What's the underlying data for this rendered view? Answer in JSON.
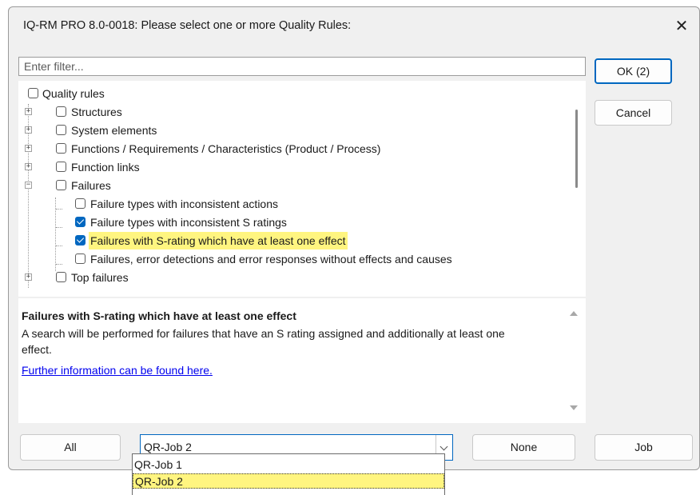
{
  "window": {
    "title": "IQ-RM PRO 8.0-0018: Please select one or more Quality Rules:",
    "close_glyph": "✕"
  },
  "filter": {
    "placeholder": "Enter filter...",
    "value": ""
  },
  "buttons": {
    "ok": "OK (2)",
    "cancel": "Cancel",
    "all": "All",
    "none": "None",
    "job": "Job"
  },
  "tree": {
    "root": {
      "label": "Quality rules",
      "checked": false
    },
    "groups": [
      {
        "label": "Structures",
        "expanded": false,
        "checked": false
      },
      {
        "label": "System elements",
        "expanded": false,
        "checked": false
      },
      {
        "label": "Functions / Requirements / Characteristics (Product / Process)",
        "expanded": false,
        "checked": false
      },
      {
        "label": "Function links",
        "expanded": false,
        "checked": false
      },
      {
        "label": "Failures",
        "expanded": true,
        "checked": false,
        "children": [
          {
            "label": "Failure types with inconsistent actions",
            "checked": false
          },
          {
            "label": "Failure types with inconsistent S ratings",
            "checked": true
          },
          {
            "label": "Failures with S-rating which have at least one effect",
            "checked": true,
            "selected": true
          },
          {
            "label": "Failures, error detections and error responses without effects and causes",
            "checked": false
          }
        ]
      },
      {
        "label": "Top failures",
        "expanded": false,
        "checked": false
      }
    ]
  },
  "description": {
    "title": "Failures with S-rating which have at least one effect",
    "text": "A search will be performed for failures that have an S rating assigned and additionally at least one effect.",
    "link": "Further information can be found here."
  },
  "job_select": {
    "value": "QR-Job 2",
    "options": [
      {
        "label": "QR-Job 1",
        "selected": false
      },
      {
        "label": "QR-Job 2",
        "selected": true
      }
    ]
  },
  "colors": {
    "accent": "#0067c0",
    "highlight": "#fff580",
    "link": "#0000ee"
  },
  "icons": [
    "close-icon",
    "plus-expander-icon",
    "minus-expander-icon",
    "checkbox-icon",
    "chevron-down-icon",
    "scroll-up-icon",
    "scroll-down-icon"
  ]
}
